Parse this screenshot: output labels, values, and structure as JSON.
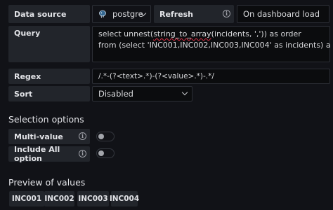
{
  "datasource": {
    "label": "Data source",
    "value": "postgre"
  },
  "refresh": {
    "label": "Refresh",
    "value": "On dashboard load"
  },
  "query": {
    "label": "Query",
    "line1_pre": "select unnest(",
    "line1_err": "string_to_array",
    "line1_post": "(incidents, ',')) as order",
    "line2": "from (select 'INC001,INC002,INC003,INC004' as incidents) a"
  },
  "regex": {
    "label": "Regex",
    "value": "/.*-(?<text>.*)-(?<value>.*)-.*/"
  },
  "sort": {
    "label": "Sort",
    "value": "Disabled"
  },
  "selection": {
    "title": "Selection options",
    "multi_value": {
      "label": "Multi-value",
      "enabled": false
    },
    "include_all": {
      "label": "Include All option",
      "enabled": false
    }
  },
  "preview": {
    "title": "Preview of values",
    "values": [
      "INC001",
      "INC002",
      "INC003",
      "INC004"
    ]
  },
  "colors": {
    "background": "#111217",
    "label_bg": "#22252b",
    "field_bg": "#0b0c0e",
    "error_underline": "#e02f44"
  },
  "icons": [
    "postgres-icon",
    "info-icon",
    "chevron-down-icon"
  ]
}
